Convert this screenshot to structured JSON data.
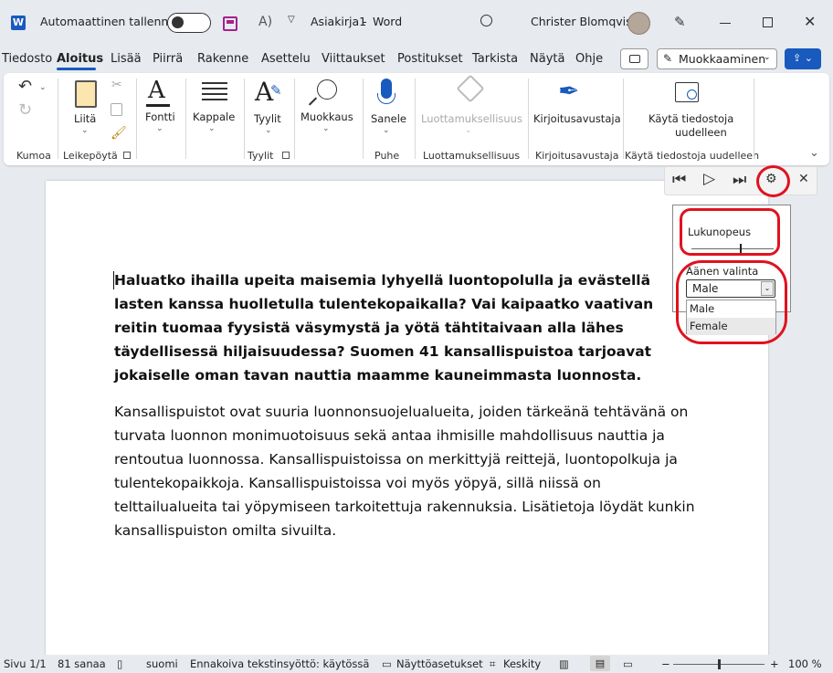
{
  "titlebar": {
    "autosave": "Automaattinen tallennus",
    "doc_title": "Asiakirja1",
    "sep": "-",
    "app": "Word",
    "user": "Christer Blomqvist"
  },
  "tabs": [
    "Tiedosto",
    "Aloitus",
    "Lisää",
    "Piirrä",
    "Rakenne",
    "Asettelu",
    "Viittaukset",
    "Postitukset",
    "Tarkista",
    "Näytä",
    "Ohje"
  ],
  "active_tab": "Aloitus",
  "edit_mode": "Muokkaaminen",
  "ribbon": {
    "liita": "Liitä",
    "fontti": "Fontti",
    "kappale": "Kappale",
    "tyylit": "Tyylit",
    "muokkaus": "Muokkaus",
    "sanele": "Sanele",
    "luottamuksellisuus": "Luottamuksellisuus",
    "kirjoitusavustaja": "Kirjoitusavustaja",
    "reuse1": "Käytä tiedostoja",
    "reuse2": "uudelleen"
  },
  "groups": {
    "kumoa": "Kumoa",
    "leikepoyta": "Leikepöytä",
    "tyylit": "Tyylit",
    "puhe": "Puhe",
    "luottamuksellisuus": "Luottamuksellisuus",
    "kirjoitusavustaja": "Kirjoitusavustaja",
    "reuse": "Käytä tiedostoja uudelleen"
  },
  "document": {
    "para1": "Haluatko ihailla upeita maisemia lyhyellä luontopolulla ja evästellä lasten kanssa huolletulla tulentekopaikalla? Vai kaipaatko vaativan reitin tuomaa fyysistä väsymystä ja yötä tähtitaivaan alla lähes täydellisessä hiljaisuudessa? Suomen 41 kansallispuistoa tarjoavat jokaiselle oman tavan nauttia maamme kauneimmasta luonnosta.",
    "para2": "Kansallispuistot ovat suuria luonnonsuojelualueita, joiden tärkeänä tehtävänä on turvata luonnon monimuotoisuus sekä antaa ihmisille mahdollisuus nauttia ja rentoutua luonnossa. Kansallispuistoissa on merkittyjä reittejä, luontopolkuja ja tulentekopaikkoja. Kansallispuistoissa voi myös yöpyä, sillä niissä on telttailualueita tai yöpymiseen tarkoitettuja rakennuksia. Lisätietoja löydät kunkin kansallispuiston omilta sivuilta."
  },
  "read_aloud": {
    "speed_label": "Lukunopeus",
    "speed_value": 0.6,
    "voice_label": "Äänen valinta",
    "voice_selected": "Male",
    "voice_options": [
      "Male",
      "Female"
    ]
  },
  "status": {
    "page": "Sivu 1/1",
    "words": "81 sanaa",
    "lang": "suomi",
    "predict": "Ennakoiva tekstinsyöttö: käytössä",
    "display": "Näyttöasetukset",
    "focus": "Keskity",
    "zoom": "100 %"
  },
  "colors": {
    "accent": "#185abd",
    "highlight": "#e0121e",
    "word_blue": "#185abd"
  }
}
